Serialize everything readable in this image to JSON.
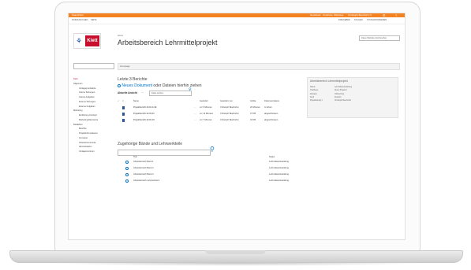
{
  "suite": {
    "left": "SharePoint",
    "right": [
      "Newsfeed",
      "OneDrive",
      "Websites"
    ],
    "user": "Christoph Beerbohm ▾",
    "gear": "⚙",
    "help": "?"
  },
  "topnav": {
    "items": [
      "DURCHSUCHEN",
      "SEITE"
    ],
    "actions": [
      "FREIGEBEN",
      "FOLGEN",
      "SYNCHRONISIEREN"
    ]
  },
  "page": {
    "small_label": "Home",
    "title": "Arbeitsbereich Lehrmittelprojekt",
    "search_placeholder": "Diese Website durchsuchen",
    "breadcrumb": "Homepage"
  },
  "logo": {
    "brand": "Klett",
    "glyph": "⚘"
  },
  "nav": [
    {
      "label": "Start",
      "level": 0,
      "selected": true
    },
    {
      "label": "Allgemein",
      "level": 0
    },
    {
      "label": "Verlagsgrundsätze",
      "level": 1
    },
    {
      "label": "Interne Sitzungen",
      "level": 1
    },
    {
      "label": "Interne Aufgaben",
      "level": 1
    },
    {
      "label": "Externe Sitzungen",
      "level": 1
    },
    {
      "label": "Externe Aufgaben",
      "level": 1
    },
    {
      "label": "Marketing",
      "level": 0
    },
    {
      "label": "Einführung Konzept",
      "level": 1
    },
    {
      "label": "Marketingdokumente",
      "level": 1
    },
    {
      "label": "Redaktion",
      "level": 0
    },
    {
      "label": "Berichte",
      "level": 1
    },
    {
      "label": "Projektinformationen",
      "level": 1
    },
    {
      "label": "Konzepte",
      "level": 1
    },
    {
      "label": "Arbeitsinstrumente",
      "level": 1
    },
    {
      "label": "Administration",
      "level": 1
    },
    {
      "label": "Vorlagenzentrum",
      "level": 1
    }
  ],
  "reports": {
    "heading": "Letzte 3 Berichte",
    "new_doc": "Neues Dokument",
    "new_doc_rest": " oder Dateien hierhin ziehen",
    "view_label": "Aktuelle Ansicht",
    "view_more": "···",
    "search_placeholder": "Datei suchen",
    "columns": [
      "Name",
      "Geändert",
      "Geändert von",
      "Größe",
      "Dokumentstatus"
    ],
    "rows": [
      {
        "name": "Projektbericht 20.04.14 ✱",
        "modified": "vor 5 Minuten",
        "by": "Christoph Beerbohm",
        "size": "20 Minuten",
        "status": "In Arbeit"
      },
      {
        "name": "Projektbericht 22.03.01",
        "modified": "vor 12 Minuten",
        "by": "Christoph Beerbohm",
        "size": "37 KB",
        "status": "abgeschlossen"
      },
      {
        "name": "Projektbericht 20.02.16",
        "modified": "vor 7 Minuten",
        "by": "Christoph Beerbohm",
        "size": "34 KB",
        "status": "abgeschlossen"
      }
    ]
  },
  "volumes": {
    "heading": "Zugehörige Bände und Lehrwerkteile",
    "columns": [
      "Titel",
      "Status"
    ],
    "rows": [
      {
        "title": "Arbeitsbereich Band 1",
        "status": "Lehrmittelentwicklung"
      },
      {
        "title": "Arbeitsbereich Band 2",
        "status": "Lehrmittelentwicklung"
      },
      {
        "title": "Arbeitsbereich Band 3",
        "status": "Lehrmittelentwicklung"
      },
      {
        "title": "Arbeitsbereich Lehrwerkteil 1",
        "status": "Lehrmittelentwicklung"
      }
    ]
  },
  "info_panel": {
    "title": "Arbeitsbereich Lehrmittelprojekt",
    "rows": [
      {
        "k": "Status",
        "v": "Lehrmittelentwicklung"
      },
      {
        "k": "Titel/Serie",
        "v": "Demo Projekt 2"
      },
      {
        "k": "Zielstufe",
        "v": "Volksschule"
      },
      {
        "k": "Fach",
        "v": "Deutsch"
      },
      {
        "k": "Projektleitung 1",
        "v": "Christoph Beerbohm"
      }
    ]
  },
  "colors": {
    "suitebar": "#f58220",
    "klett_red": "#c8102e",
    "link_blue": "#0072c6"
  }
}
